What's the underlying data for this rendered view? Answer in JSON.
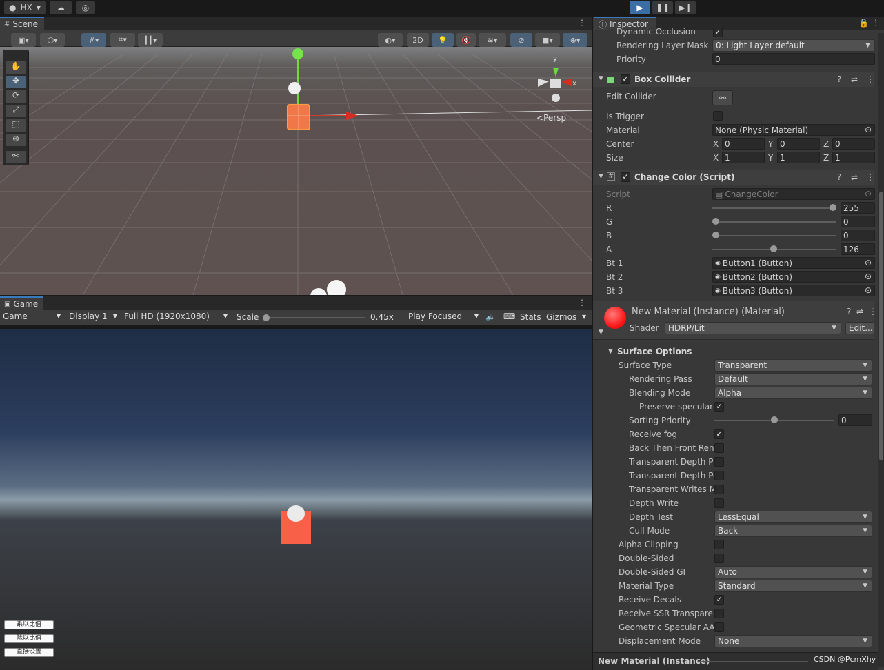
{
  "topbar": {
    "account": "HX",
    "play_icon": "play-icon",
    "pause_icon": "pause-icon",
    "step_icon": "step-icon"
  },
  "scene": {
    "tab_label": "Scene",
    "persp_label": "Persp",
    "btn_2d": "2D"
  },
  "game": {
    "tab_label": "Game",
    "view_select": "Game",
    "display_select": "Display 1",
    "resolution_select": "Full HD (1920x1080)",
    "scale_label": "Scale",
    "scale_value": "0.45x",
    "play_mode_select": "Play Focused",
    "stats_label": "Stats",
    "gizmos_label": "Gizmos",
    "ui_buttons": [
      "乘以比值",
      "除以比值",
      "直接设置"
    ]
  },
  "inspector": {
    "tab_label": "Inspector",
    "top_rows": [
      {
        "label": "Dynamic Occlusion",
        "checked": true
      },
      {
        "label": "Rendering Layer Mask",
        "value": "0: Light Layer default"
      },
      {
        "label": "Priority",
        "value": "0"
      }
    ],
    "box_collider": {
      "title": "Box Collider",
      "edit_collider": "Edit Collider",
      "is_trigger": "Is Trigger",
      "material_label": "Material",
      "material_value": "None (Physic Material)",
      "center_label": "Center",
      "center": {
        "x": "0",
        "y": "0",
        "z": "0"
      },
      "size_label": "Size",
      "size": {
        "x": "1",
        "y": "1",
        "z": "1"
      },
      "axis_x": "X",
      "axis_y": "Y",
      "axis_z": "Z"
    },
    "change_color": {
      "title": "Change Color (Script)",
      "script_label": "Script",
      "script_value": "ChangeColor",
      "r_label": "R",
      "r_value": "255",
      "r_fraction": 1.0,
      "g_label": "G",
      "g_value": "0",
      "g_fraction": 0.0,
      "b_label": "B",
      "b_value": "0",
      "b_fraction": 0.0,
      "a_label": "A",
      "a_value": "126",
      "a_fraction": 0.494,
      "bt1_label": "Bt 1",
      "bt1_value": "Button1 (Button)",
      "bt2_label": "Bt 2",
      "bt2_value": "Button2 (Button)",
      "bt3_label": "Bt 3",
      "bt3_value": "Button3 (Button)"
    },
    "material": {
      "title": "New Material (Instance) (Material)",
      "shader_label": "Shader",
      "shader_value": "HDRP/Lit",
      "edit_button": "Edit...",
      "swatch_color": "#ff2a2a"
    },
    "surface_options": {
      "title": "Surface Options",
      "surface_type_label": "Surface Type",
      "surface_type_value": "Transparent",
      "rendering_pass_label": "Rendering Pass",
      "rendering_pass_value": "Default",
      "blending_mode_label": "Blending Mode",
      "blending_mode_value": "Alpha",
      "preserve_specular_label": "Preserve specular l",
      "sorting_priority_label": "Sorting Priority",
      "sorting_priority_value": "0",
      "sorting_priority_fraction": 0.5,
      "receive_fog_label": "Receive fog",
      "back_then_front_label": "Back Then Front Renc",
      "transparent_depth_pre_label": "Transparent Depth Pr",
      "transparent_depth_post_label": "Transparent Depth Po",
      "transparent_writes_label": "Transparent Writes M",
      "depth_write_label": "Depth Write",
      "depth_test_label": "Depth Test",
      "depth_test_value": "LessEqual",
      "cull_mode_label": "Cull Mode",
      "cull_mode_value": "Back",
      "alpha_clipping_label": "Alpha Clipping",
      "double_sided_label": "Double-Sided",
      "double_sided_gi_label": "Double-Sided GI",
      "double_sided_gi_value": "Auto",
      "material_type_label": "Material Type",
      "material_type_value": "Standard",
      "receive_decals_label": "Receive Decals",
      "receive_ssr_label": "Receive SSR Transparer",
      "geometric_specular_label": "Geometric Specular AA",
      "displacement_mode_label": "Displacement Mode",
      "displacement_mode_value": "None"
    },
    "footer_title": "New Material (Instance)",
    "watermark": "CSDN @PcmXhy"
  }
}
